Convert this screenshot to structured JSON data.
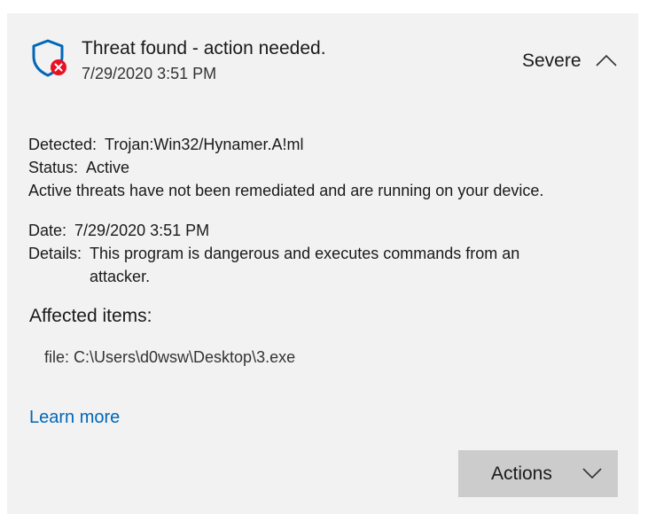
{
  "alert": {
    "title": "Threat found - action needed.",
    "timestamp": "7/29/2020 3:51 PM",
    "severity": "Severe"
  },
  "details": {
    "detected_label": "Detected:",
    "detected_value": "Trojan:Win32/Hynamer.A!ml",
    "status_label": "Status:",
    "status_value": "Active",
    "status_message": "Active threats have not been remediated and are running on your device.",
    "date_label": "Date:",
    "date_value": "7/29/2020 3:51 PM",
    "details_label": "Details:",
    "details_value": "This program is dangerous and executes commands from an attacker."
  },
  "affected": {
    "heading": "Affected items:",
    "items": [
      "file: C:\\Users\\d0wsw\\Desktop\\3.exe"
    ]
  },
  "links": {
    "learn_more": "Learn more"
  },
  "actions": {
    "label": "Actions"
  },
  "icons": {
    "shield": "shield-icon",
    "error_badge": "error-badge-icon",
    "collapse": "chevron-up-icon",
    "dropdown": "chevron-down-icon"
  },
  "colors": {
    "card_background": "#f2f2f2",
    "shield_blue": "#0067b8",
    "error_red": "#e81123",
    "link_blue": "#0067b8",
    "button_gray": "#cccccc"
  }
}
